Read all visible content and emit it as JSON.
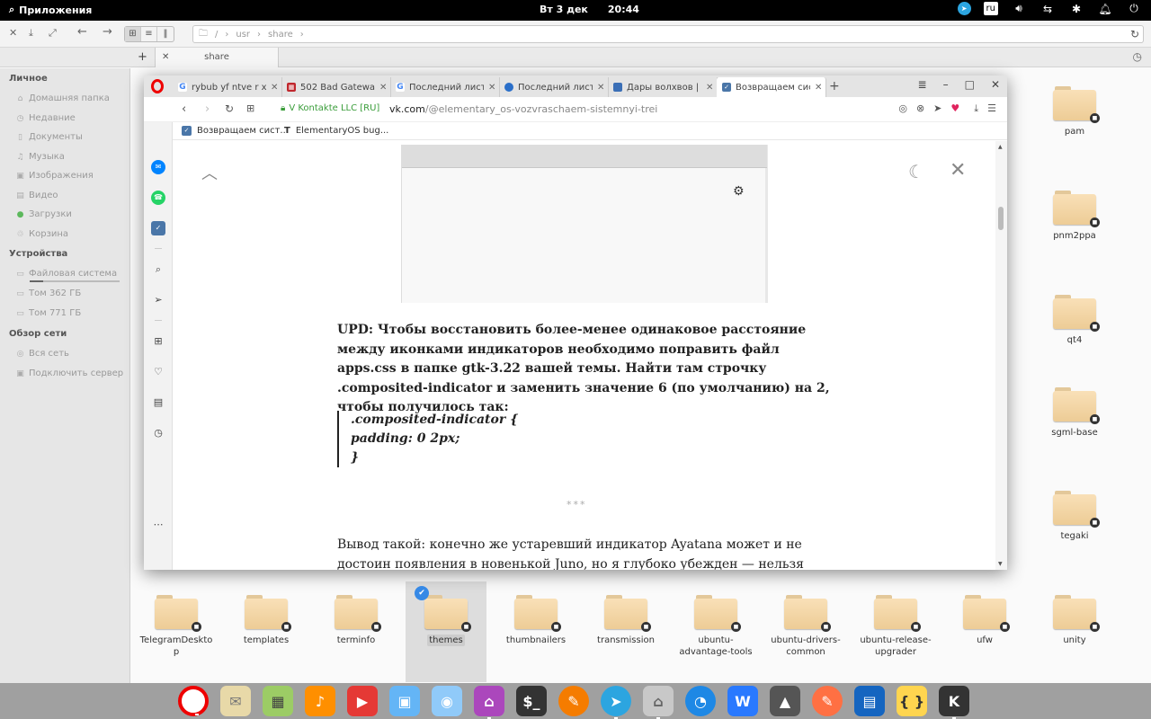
{
  "panel": {
    "apps_label": "Приложения",
    "date": "Вт  3 дек",
    "time": "20:44",
    "lang": "ru"
  },
  "fm": {
    "path": [
      "/",
      "usr",
      "share"
    ],
    "tab_label": "share",
    "sidebar": {
      "personal_header": "Личное",
      "personal": [
        "Домашняя папка",
        "Недавние",
        "Документы",
        "Музыка",
        "Изображения",
        "Видео",
        "Загрузки",
        "Корзина"
      ],
      "devices_header": "Устройства",
      "devices": [
        "Файловая система",
        "Том 362 ГБ",
        "Том 771 ГБ"
      ],
      "network_header": "Обзор сети",
      "network": [
        "Вся сеть",
        "Подключить сервер"
      ]
    },
    "right_folders": [
      "pam",
      "pnm2ppa",
      "qt4",
      "sgml-base",
      "tegaki"
    ],
    "bottom_folders": [
      "TelegramDesktop",
      "templates",
      "terminfo",
      "themes",
      "thumbnailers",
      "transmission",
      "ubuntu-advantage-tools",
      "ubuntu-drivers-common",
      "ubuntu-release-upgrader",
      "ufw",
      "unity"
    ],
    "bottom_folders_display": [
      [
        "TelegramDeskto",
        "p"
      ],
      [
        "templates"
      ],
      [
        "terminfo"
      ],
      [
        "themes"
      ],
      [
        "thumbnailers"
      ],
      [
        "transmission"
      ],
      [
        "ubuntu-",
        "advantage-tools"
      ],
      [
        "ubuntu-drivers-",
        "common"
      ],
      [
        "ubuntu-release-",
        "upgrader"
      ],
      [
        "ufw"
      ],
      [
        "unity"
      ]
    ]
  },
  "browser": {
    "tabs": [
      {
        "title": "rybub yf ntve r xtve",
        "icon": "google"
      },
      {
        "title": "502 Bad Gateway",
        "icon": "error"
      },
      {
        "title": "Последний лист",
        "icon": "google"
      },
      {
        "title": "Последний лист",
        "icon": "globe"
      },
      {
        "title": "Дары волхвов | В",
        "icon": "page"
      },
      {
        "title": "Возвращаем сист",
        "icon": "vk",
        "active": true
      }
    ],
    "security_label": "V Kontakte LLC [RU]",
    "url_domain": "vk.com",
    "url_path": "/@elementary_os-vozvraschaem-sistemnyi-trei",
    "bookmarks": [
      "Возвращаем сист...",
      "ElementaryOS bug..."
    ],
    "article": {
      "upd_text": "UPD: Чтобы восстановить более-менее одинаковое расстояние между иконками индикаторов необходимо поправить файл apps.css в папке gtk-3.22 вашей темы. Найти там строчку .composited-indicator и заменить значение 6 (по умолчанию) на 2, чтобы получилось так:",
      "code_lines": [
        ".composited-indicator {",
        "padding: 0 2px;",
        "}"
      ],
      "separator": "***",
      "conclusion": "Вывод такой: конечно же устаревший индикатор Ayatana может и не достоин появления в новенькой Juno, но я глубоко убежден — нельзя лишать"
    }
  },
  "colors": {
    "opera_red": "#e00000",
    "vk_blue": "#4a76a8",
    "secure_green": "#3a9d3a",
    "selection_blue": "#3689e6"
  }
}
